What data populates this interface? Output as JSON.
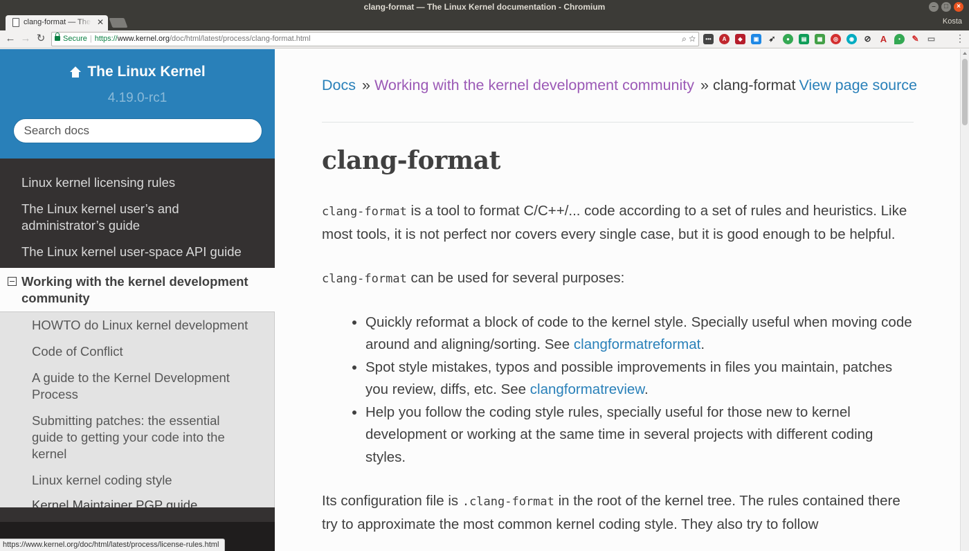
{
  "window": {
    "title": "clang-format — The Linux Kernel documentation - Chromium",
    "profile_name": "Kosta"
  },
  "tab": {
    "title": "clang-format — The Linux Kernel documentation"
  },
  "omnibox": {
    "secure_label": "Secure",
    "url_scheme": "https://",
    "url_host": "www.kernel.org",
    "url_path": "/doc/html/latest/process/clang-format.html"
  },
  "status_bubble": "https://www.kernel.org/doc/html/latest/process/license-rules.html",
  "sidebar": {
    "project_title": "The Linux Kernel",
    "version": "4.19.0-rc1",
    "search_placeholder": "Search docs",
    "top_items": [
      "Linux kernel licensing rules",
      "The Linux kernel user’s and administrator’s guide",
      "The Linux kernel user-space API guide"
    ],
    "current_section": "Working with the kernel development community",
    "sub_items": [
      "HOWTO do Linux kernel development",
      "Code of Conflict",
      "A guide to the Kernel Development Process",
      "Submitting patches: the essential guide to getting your code into the kernel",
      "Linux kernel coding style",
      "Kernel Maintainer PGP guide"
    ]
  },
  "breadcrumbs": {
    "home": "Docs",
    "separator": "»",
    "parent": "Working with the kernel development community",
    "current": "clang-format",
    "view_source": "View page source"
  },
  "article": {
    "title": "clang-format",
    "intro_code": "clang-format",
    "intro_text": " is a tool to format C/C++/... code according to a set of rules and heuristics. Like most tools, it is not perfect nor covers every single case, but it is good enough to be helpful.",
    "purposes_code": "clang-format",
    "purposes_text": " can be used for several purposes:",
    "bullets": [
      {
        "text": "Quickly reformat a block of code to the kernel style. Specially useful when moving code around and aligning/sorting. See ",
        "link": "clangformatreformat",
        "tail": "."
      },
      {
        "text": "Spot style mistakes, typos and possible improvements in files you maintain, patches you review, diffs, etc. See ",
        "link": "clangformatreview",
        "tail": "."
      },
      {
        "text": "Help you follow the coding style rules, specially useful for those new to kernel development or working at the same time in several projects with different coding styles.",
        "link": "",
        "tail": ""
      }
    ],
    "config_text_1": "Its configuration file is ",
    "config_code": ".clang-format",
    "config_text_2": " in the root of the kernel tree. The rules contained there try to approximate the most common kernel coding style. They also try to follow"
  }
}
